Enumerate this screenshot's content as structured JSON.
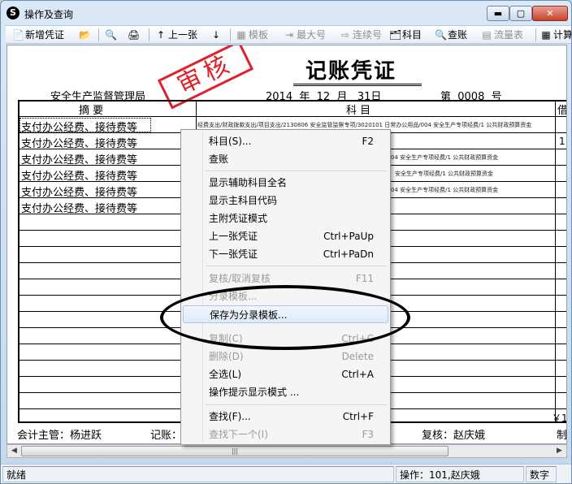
{
  "window": {
    "title": "操作及查询",
    "icon_glyph": "S",
    "min_glyph": "▬",
    "max_glyph": "▢",
    "close_glyph": "✕"
  },
  "toolbar": {
    "new_voucher": "新增凭证",
    "prev": "上一张",
    "template": "模板",
    "last_no": "最大号",
    "continuous_no": "连续号",
    "subject": "科目",
    "lookup": "查账",
    "cashflow": "流量表",
    "calc": "计算",
    "icons": {
      "new": "📄",
      "open": "📂",
      "preview": "🔍",
      "print": "🖨",
      "up": "↑",
      "down": "↓",
      "template": "▦",
      "last": "⇥",
      "continuous": "⇨",
      "subject": "🗂",
      "lookup": "🔍",
      "cashflow": "▤",
      "calc": "▦"
    }
  },
  "voucher": {
    "title": "记账凭证",
    "stamp": "审核",
    "org": "安全生产监督管理局",
    "date": "2014  年  12  月   31日",
    "number": "第  0008  号",
    "head_summary": "摘    要",
    "head_subject": "科    目",
    "head_debit": "借",
    "rows": [
      {
        "summary": "支付办公经费、接待费等",
        "subject": "经费支出/财政拨款支出/项目支出/2130806 安全监管监察专项/3020101 日常办公用品/004 安全生产专项经费/1 公共财政预算资金",
        "debit": ""
      },
      {
        "summary": "支付办公经费、接待费等",
        "subject": "",
        "debit": "1"
      },
      {
        "summary": "支付办公经费、接待费等",
        "subject": "04 安全生产专项经费/1 公共财政预算资金",
        "debit": ""
      },
      {
        "summary": "支付办公经费、接待费等",
        "subject": "安全生产专项经费/1 公共财政预算资金",
        "debit": ""
      },
      {
        "summary": "支付办公经费、接待费等",
        "subject": "04 安全生产专项经费/1 公共财政预算资金",
        "debit": ""
      },
      {
        "summary": "支付办公经费、接待费等",
        "subject": "",
        "debit": ""
      }
    ],
    "total_debit": "￥1",
    "supervisor": "会计主管：杨进跃",
    "bookkeeper": "记账：",
    "reviewer": "复核：赵庆娥",
    "maker": "制"
  },
  "context_menu": {
    "items": [
      {
        "label": "科目(S)...",
        "shortcut": "F2",
        "enabled": true
      },
      {
        "label": "查账",
        "shortcut": "",
        "enabled": true
      },
      {
        "label": "显示辅助科目全名",
        "shortcut": "",
        "enabled": true
      },
      {
        "label": "显示主科目代码",
        "shortcut": "",
        "enabled": true
      },
      {
        "label": "主附凭证模式",
        "shortcut": "",
        "enabled": true
      },
      {
        "label": "上一张凭证",
        "shortcut": "Ctrl+PaUp",
        "enabled": true
      },
      {
        "label": "下一张凭证",
        "shortcut": "Ctrl+PaDn",
        "enabled": true
      },
      {
        "label": "复核/取消复核",
        "shortcut": "F11",
        "enabled": false
      },
      {
        "label": "分录模板...",
        "shortcut": "",
        "enabled": false
      },
      {
        "label": "保存为分录模板...",
        "shortcut": "",
        "enabled": true
      },
      {
        "label": "复制(C)",
        "shortcut": "Ctrl+C",
        "enabled": false
      },
      {
        "label": "删除(D)",
        "shortcut": "Delete",
        "enabled": false
      },
      {
        "label": "全选(L)",
        "shortcut": "Ctrl+A",
        "enabled": true
      },
      {
        "label": "操作提示显示模式 ...",
        "shortcut": "",
        "enabled": true
      },
      {
        "label": "查找(F)...",
        "shortcut": "Ctrl+F",
        "enabled": true
      },
      {
        "label": "查找下一个(I)",
        "shortcut": "F3",
        "enabled": false
      }
    ]
  },
  "scroll": {
    "left": "◀",
    "right": "▶",
    "grip": "|||"
  },
  "status": {
    "ready": "就绪",
    "operator": "操作：101,赵庆娥",
    "mode": "数字"
  }
}
